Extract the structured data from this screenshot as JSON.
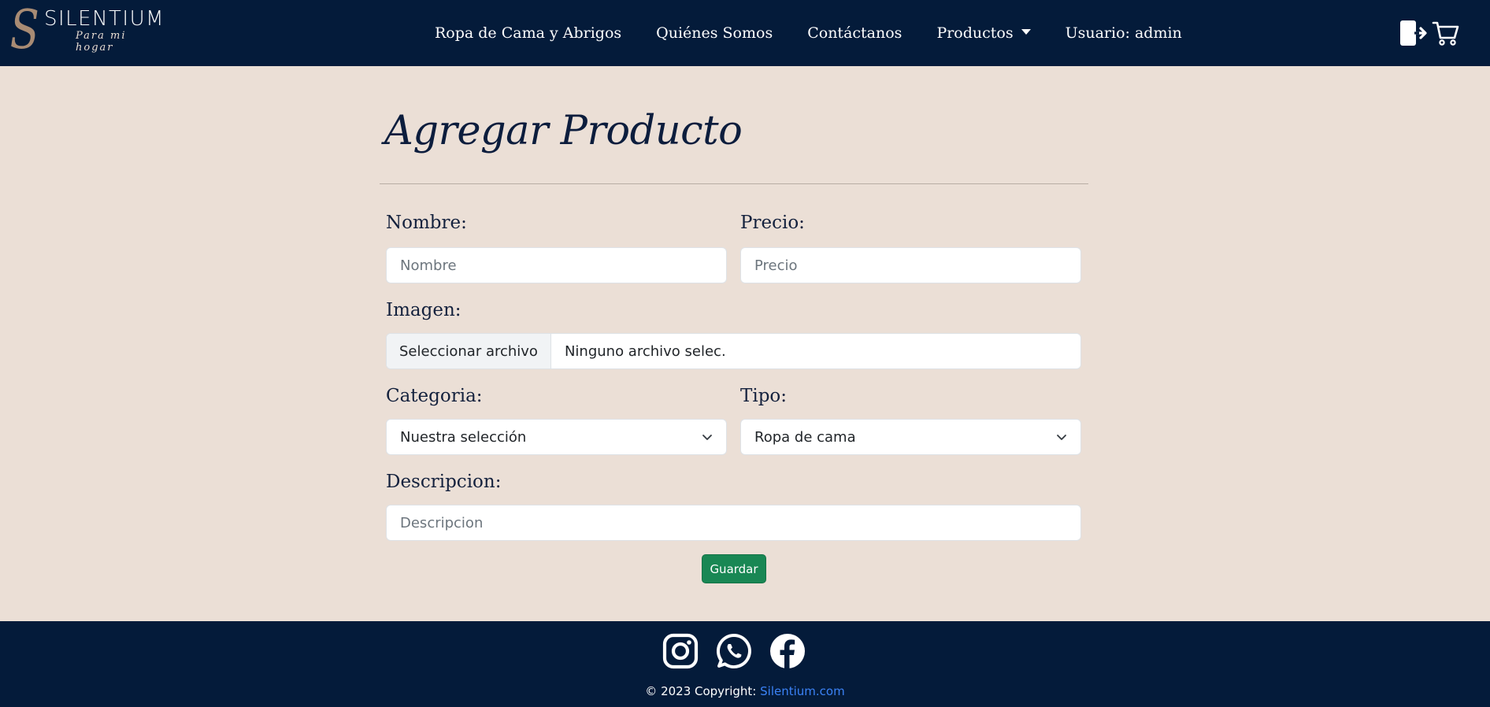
{
  "brand": {
    "name": "SILENTIUM",
    "tagline": "Para mi hogar",
    "mark": "S"
  },
  "nav": {
    "items": [
      {
        "label": "Ropa de Cama y Abrigos"
      },
      {
        "label": "Quiénes Somos"
      },
      {
        "label": "Contáctanos"
      },
      {
        "label": "Productos"
      },
      {
        "label": "Usuario: admin"
      }
    ],
    "icons": [
      "logout-icon",
      "cart-icon"
    ]
  },
  "page": {
    "title": "Agregar Producto"
  },
  "form": {
    "nombre": {
      "label": "Nombre:",
      "placeholder": "Nombre"
    },
    "precio": {
      "label": "Precio:",
      "placeholder": "Precio"
    },
    "imagen": {
      "label": "Imagen:",
      "button": "Seleccionar archivo",
      "file_status": "Ninguno archivo selec."
    },
    "categoria": {
      "label": "Categoria:",
      "selected": "Nuestra selección"
    },
    "tipo": {
      "label": "Tipo:",
      "selected": "Ropa de cama"
    },
    "descripcion": {
      "label": "Descripcion:",
      "placeholder": "Descripcion"
    },
    "submit": "Guardar"
  },
  "footer": {
    "social": [
      "instagram-icon",
      "whatsapp-icon",
      "facebook-icon"
    ],
    "copyright_prefix": "© 2023 Copyright: ",
    "copyright_link": "Silentium.com"
  },
  "colors": {
    "navbar_bg": "#041b3a",
    "page_bg": "#ebdfd6",
    "save_button": "#198754",
    "link": "#3b82f6",
    "logo_accent": "#a88b74"
  }
}
